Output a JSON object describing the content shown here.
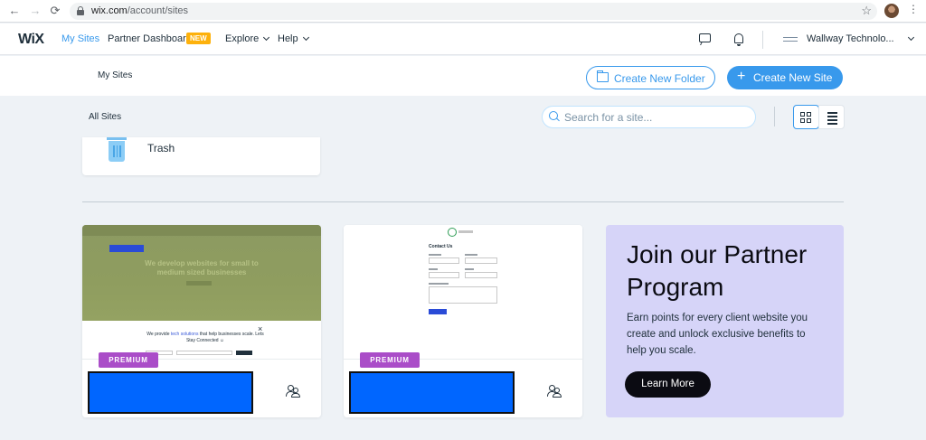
{
  "browser": {
    "back_icon": "←",
    "forward_icon": "→",
    "reload_icon": "⟳",
    "url_host": "wix.com",
    "url_path": "/account/sites",
    "star_icon": "☆",
    "menu_icon": "⋮"
  },
  "header": {
    "logo": "WiX",
    "nav": {
      "my_sites": "My Sites",
      "partner_dashboard": "Partner Dashboard",
      "new_badge": "NEW",
      "explore": "Explore",
      "help": "Help"
    },
    "account_name": "Wallway Technolo..."
  },
  "subheader": {
    "title": "My Sites",
    "create_folder_label": "Create New Folder",
    "create_site_label": "Create New Site",
    "plus_glyph": "+"
  },
  "filters": {
    "all_sites_label": "All Sites",
    "search_placeholder": "Search for a site..."
  },
  "trash": {
    "label": "Trash"
  },
  "site_cards": [
    {
      "badge": "PREMIUM",
      "thumbnail": {
        "headline": "We develop websites for small to medium sized businesses",
        "modal_text_1": "We provide ",
        "modal_highlight": "tech solutions",
        "modal_text_2": " that help businesses scale. Lets Stay Connected ☺",
        "close_glyph": "×"
      }
    },
    {
      "badge": "PREMIUM",
      "thumbnail": {
        "form_title": "Contact Us"
      }
    }
  ],
  "promo": {
    "title": "Join our Partner Program",
    "body": "Earn points for every client website you create and unlock exclusive benefits to help you scale.",
    "button_label": "Learn More"
  },
  "colors": {
    "accent": "#3899ec",
    "badge_new": "#fdb10c",
    "premium": "#aa4dc8",
    "promo_bg": "#d6d4f8",
    "redaction": "#0066ff"
  }
}
